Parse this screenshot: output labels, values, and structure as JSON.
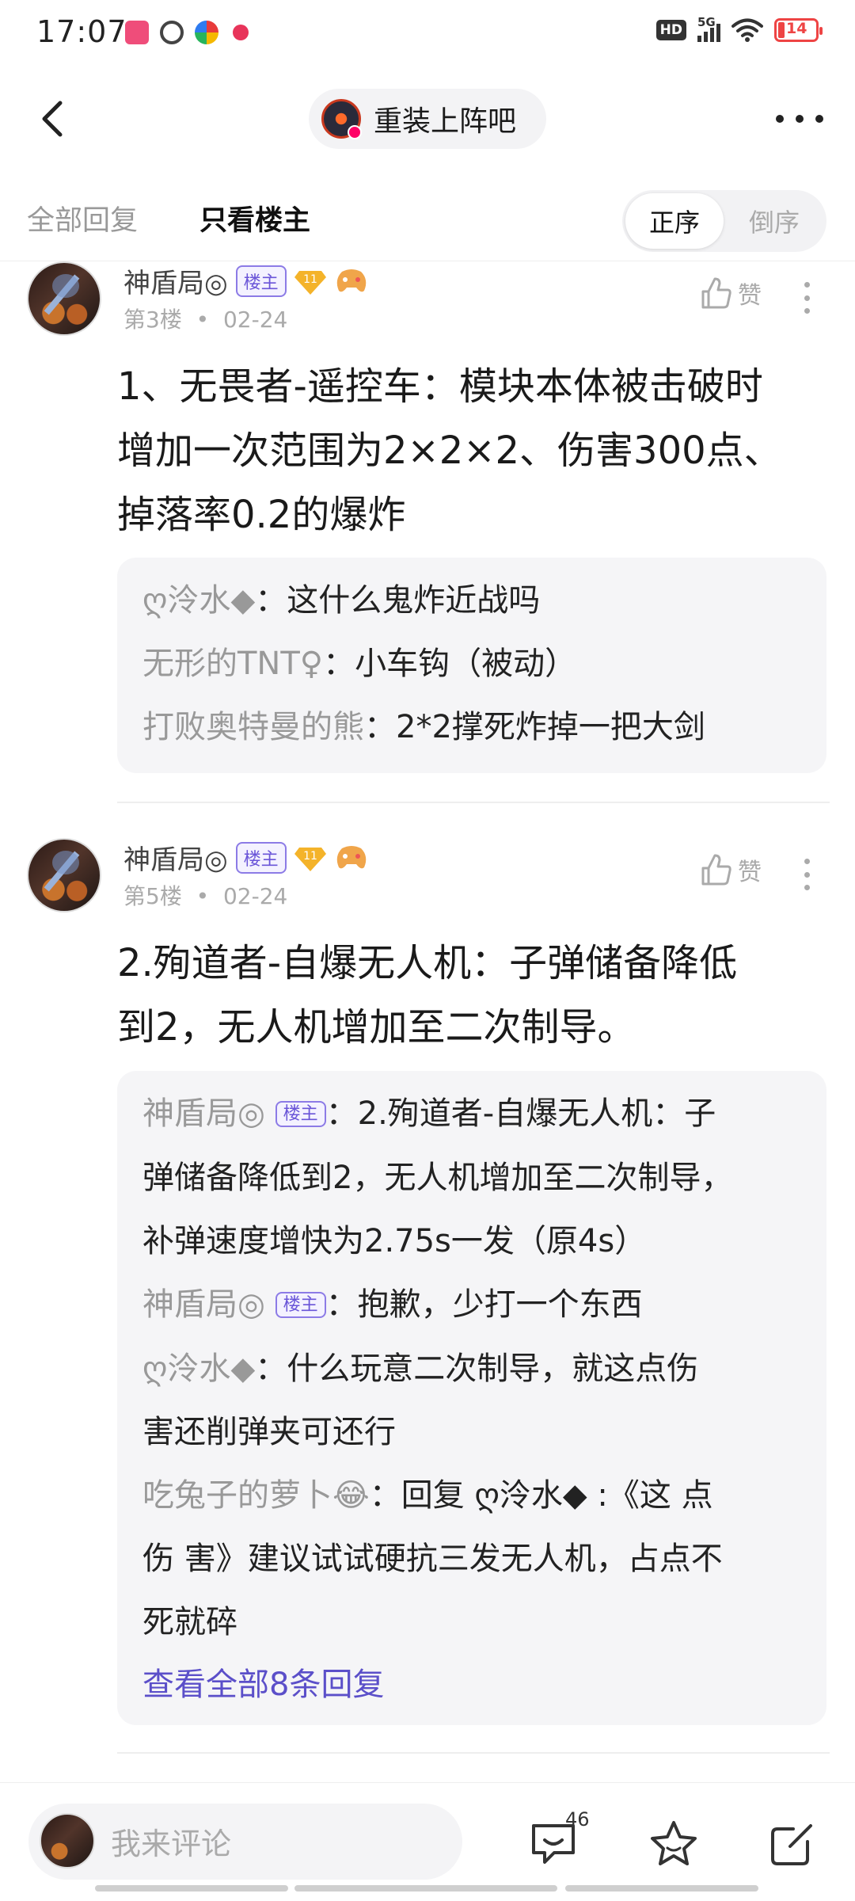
{
  "status_bar": {
    "time": "17:07",
    "network_badge": "HD",
    "network_type": "5G",
    "battery_level": "14"
  },
  "nav": {
    "forum_name": "重装上阵吧"
  },
  "filter": {
    "tab_all": "全部回复",
    "tab_owner_only": "只看楼主",
    "sort_asc": "正序",
    "sort_desc": "倒序"
  },
  "posts": [
    {
      "author": "神盾局◎",
      "owner_tag": "楼主",
      "level": "11",
      "floor": "第3楼",
      "date": "02-24",
      "like_label": "赞",
      "body_lines": [
        "1、无畏者-遥控车：模块本体被击破时",
        "增加一次范围为2×2×2、伤害300点、",
        "掉落率0.2的爆炸"
      ],
      "replies": [
        {
          "author": "ღ泠水◆",
          "text": "：这什么鬼炸近战吗"
        },
        {
          "author": "无形的TNT♀",
          "text": "：小车钩（被动）"
        },
        {
          "author": "打败奥特曼的熊",
          "text": "：2*2撑死炸掉一把大剑"
        }
      ]
    },
    {
      "author": "神盾局◎",
      "owner_tag": "楼主",
      "level": "11",
      "floor": "第5楼",
      "date": "02-24",
      "like_label": "赞",
      "body_lines": [
        "2.殉道者-自爆无人机：子弹储备降低",
        "到2，无人机增加至二次制导。"
      ],
      "replies": [
        {
          "author": "神盾局◎",
          "tag": "楼主",
          "lines": [
            "：2.殉道者-自爆无人机：子",
            "弹储备降低到2，无人机增加至二次制导，",
            "补弹速度增快为2.75s一发（原4s）"
          ]
        },
        {
          "author": "神盾局◎",
          "tag": "楼主",
          "lines": [
            "：抱歉，少打一个东西"
          ]
        },
        {
          "author": "ღ泠水◆",
          "lines": [
            "：什么玩意二次制导，就这点伤",
            "害还削弹夹可还行"
          ]
        },
        {
          "author": "吃兔子的萝卜😂",
          "lines": [
            "：回复 ღ泠水◆ :《这 点",
            "伤 害》建议试试硬抗三发无人机，占点不",
            "死就碎"
          ]
        }
      ],
      "view_all": "查看全部8条回复"
    }
  ],
  "bottom_bar": {
    "comment_placeholder": "我来评论",
    "comment_count": "46"
  }
}
